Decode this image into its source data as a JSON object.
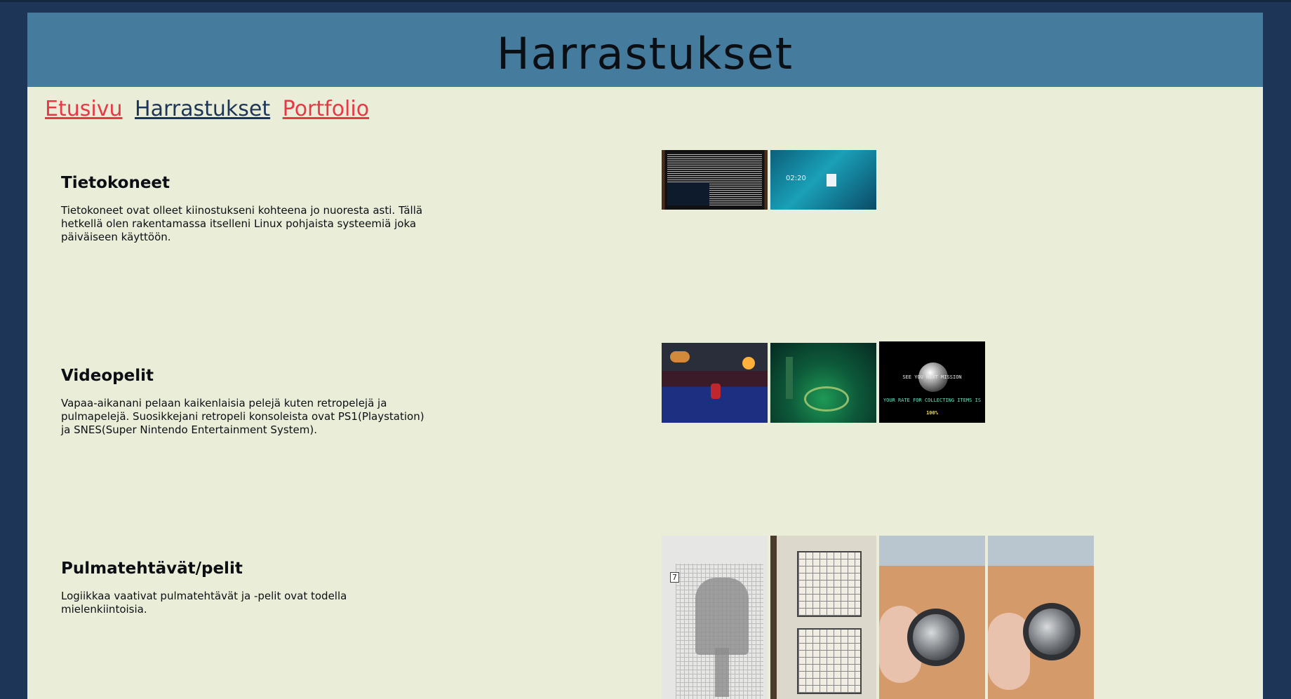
{
  "header": {
    "title": "Harrastukset"
  },
  "nav": {
    "items": [
      {
        "label": "Etusivu"
      },
      {
        "label": "Harrastukset"
      },
      {
        "label": "Portfolio"
      }
    ]
  },
  "sections": [
    {
      "title": "Tietokoneet",
      "text": "Tietokoneet ovat olleet kiinostukseni kohteena jo nuoresta asti. Tällä hetkellä olen rakentamassa itselleni Linux pohjaista systeemiä joka päiväiseen käyttöön.",
      "images": [
        {
          "icon": "terminal-screen-photo"
        },
        {
          "icon": "lock-screen-photo",
          "time": "02:20"
        }
      ]
    },
    {
      "title": "Videopelit",
      "text": "Vapaa-aikanani pelaan kaikenlaisia pelejä kuten retropelejä ja pulmapelejä. Suosikkejani retropeli konsoleista ovat PS1(Playstation) ja SNES(Super Nintendo Entertainment System).",
      "images": [
        {
          "icon": "game-screenshot-1"
        },
        {
          "icon": "game-screenshot-2"
        },
        {
          "icon": "game-screenshot-3",
          "line1": "SEE YOU NEXT MISSION",
          "line2": "YOUR RATE FOR COLLECTING ITEMS IS",
          "line3": "100%"
        }
      ]
    },
    {
      "title": "Pulmatehtävät/pelit",
      "text": "Logiikkaa vaativat pulmatehtävät ja -pelit ovat todella mielenkiintoisia.",
      "images": [
        {
          "icon": "nonogram-photo",
          "number": "7"
        },
        {
          "icon": "sudoku-book-photo"
        },
        {
          "icon": "metal-puzzle-photo-1"
        },
        {
          "icon": "metal-puzzle-photo-2"
        }
      ]
    }
  ]
}
